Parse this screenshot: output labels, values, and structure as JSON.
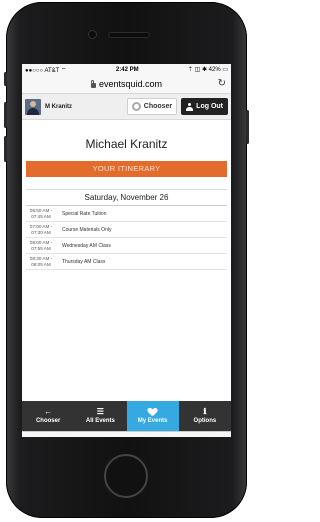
{
  "status": {
    "carrier": "●●○○○ AT&T ⌔",
    "time": "2:42 PM",
    "battery": "⇡ ◫ ✱ 42% ▭"
  },
  "browser": {
    "url": "eventsquid.com",
    "reload_icon": "↻"
  },
  "header": {
    "user_name": "M Kranitz",
    "chooser_label": "Chooser",
    "logout_label": "Log Out"
  },
  "profile": {
    "full_name": "Michael Kranitz"
  },
  "itinerary": {
    "banner": "YOUR ITINERARY",
    "day": "Saturday, November 26",
    "rows": [
      {
        "time_start": "06:50 AM -",
        "time_end": "07:45 AM",
        "title": "Special Rate Tuition"
      },
      {
        "time_start": "07:00 AM -",
        "time_end": "07:30 AM",
        "title": "Course Materials Only"
      },
      {
        "time_start": "08:00 AM -",
        "time_end": "07:55 AM",
        "title": "Wednesday AM Class"
      },
      {
        "time_start": "08:30 AM -",
        "time_end": "08:05 AM",
        "title": "Thursday AM Class"
      }
    ]
  },
  "tabs": [
    {
      "label": "Chooser",
      "icon": "←",
      "icon_name": "arrow-left-icon"
    },
    {
      "label": "All Events",
      "icon": "☰",
      "icon_name": "list-icon"
    },
    {
      "label": "My Events",
      "icon": "",
      "icon_name": "heart-icon"
    },
    {
      "label": "Options",
      "icon": "ℹ",
      "icon_name": "info-icon"
    }
  ],
  "browser_toolbar": {
    "back": "‹",
    "forward": "›",
    "share": "⇪",
    "bookmarks": "⊓⊓",
    "tabs": "⧉"
  },
  "colors": {
    "accent_orange": "#e36b2c",
    "active_tab": "#35a9e0",
    "tabbar": "#333333"
  }
}
